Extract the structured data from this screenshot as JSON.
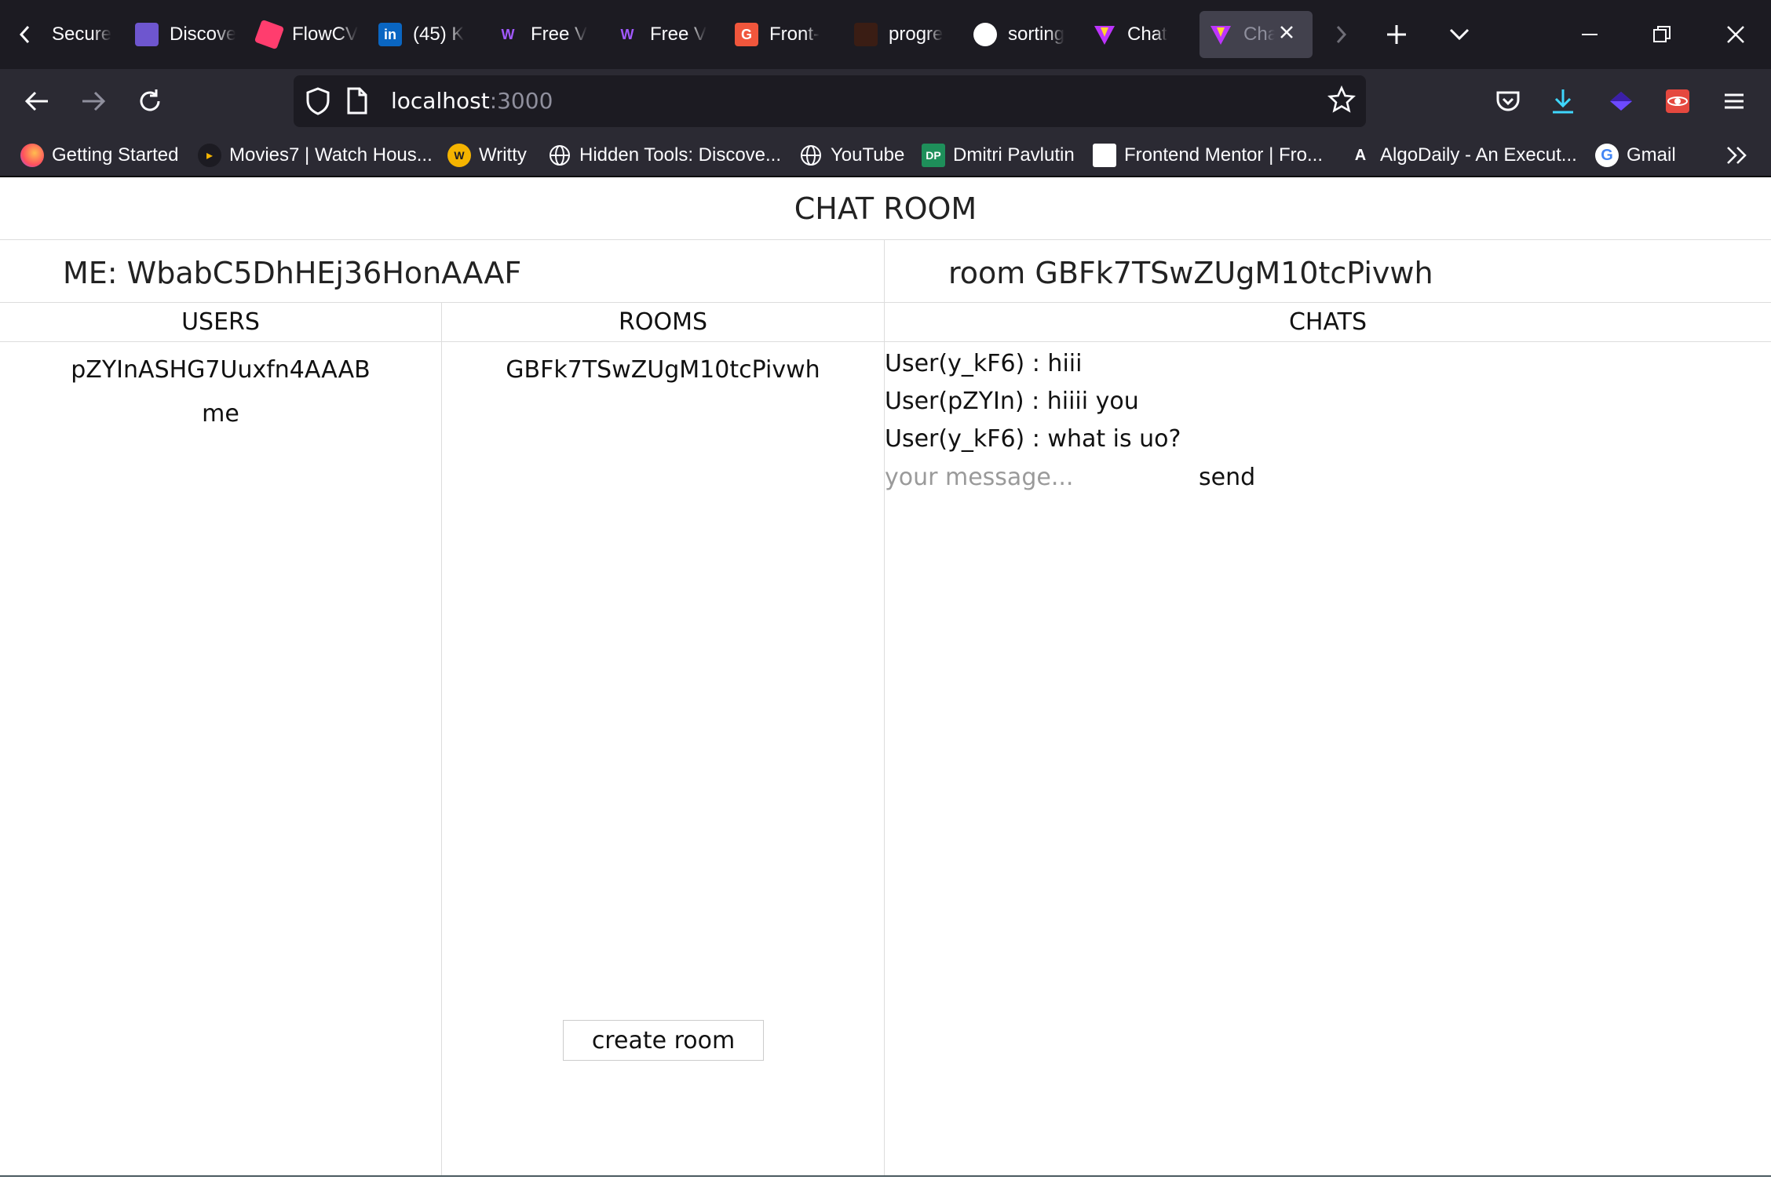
{
  "browser": {
    "tabs": [
      {
        "label": "Secure",
        "icon": "lock-favicon",
        "color": "#000000"
      },
      {
        "label": "Discover",
        "icon": "discord-purple-favicon",
        "color": "#6e56cf"
      },
      {
        "label": "FlowCV",
        "icon": "flowcv-favicon",
        "color": "#ff3d6e"
      },
      {
        "label": "(45) K",
        "icon": "linkedin-favicon",
        "color": "#0a66c2"
      },
      {
        "label": "Free V",
        "icon": "webflow-favicon",
        "color": "#a259ff"
      },
      {
        "label": "Free V",
        "icon": "webflow-favicon",
        "color": "#a259ff"
      },
      {
        "label": "Front-",
        "icon": "grammarly-favicon",
        "color": "#f0563c"
      },
      {
        "label": "progre",
        "icon": "progress-favicon",
        "color": "#3a1d14"
      },
      {
        "label": "sorting",
        "icon": "github-favicon",
        "color": "#ffffff"
      },
      {
        "label": "Chat",
        "icon": "vite-favicon",
        "color": "#bd34fe"
      },
      {
        "label": "Chat",
        "icon": "vite-favicon",
        "color": "#bd34fe",
        "active": true
      }
    ],
    "url_host": "localhost",
    "url_port": ":3000",
    "bookmarks": [
      {
        "label": "Getting Started",
        "icon": "firefox-icon"
      },
      {
        "label": "Movies7 | Watch Hous...",
        "icon": "play-icon"
      },
      {
        "label": "Writty",
        "icon": "writty-icon"
      },
      {
        "label": "Hidden Tools: Discove...",
        "icon": "globe-icon"
      },
      {
        "label": "YouTube",
        "icon": "globe-icon"
      },
      {
        "label": "Dmitri Pavlutin",
        "icon": "dp-icon"
      },
      {
        "label": "Frontend Mentor | Fro...",
        "icon": "frontend-mentor-icon"
      },
      {
        "label": "AlgoDaily - An Execut...",
        "icon": "algodaily-icon"
      },
      {
        "label": "Gmail",
        "icon": "google-icon"
      }
    ]
  },
  "app": {
    "title": "CHAT ROOM",
    "me_label": "ME: WbabC5DhHEj36HonAAAF",
    "room_label": "room GBFk7TSwZUgM10tcPivwh",
    "users_header": "USERS",
    "rooms_header": "ROOMS",
    "chats_header": "CHATS",
    "users": [
      "pZYInASHG7Uuxfn4AAAB",
      "me"
    ],
    "rooms": [
      "GBFk7TSwZUgM10tcPivwh"
    ],
    "messages": [
      "User(y_kF6) : hiii",
      "User(pZYIn) : hiiii you",
      "User(y_kF6) : what is uo?"
    ],
    "message_placeholder": "your message...",
    "send_label": "send",
    "create_room_label": "create room"
  }
}
